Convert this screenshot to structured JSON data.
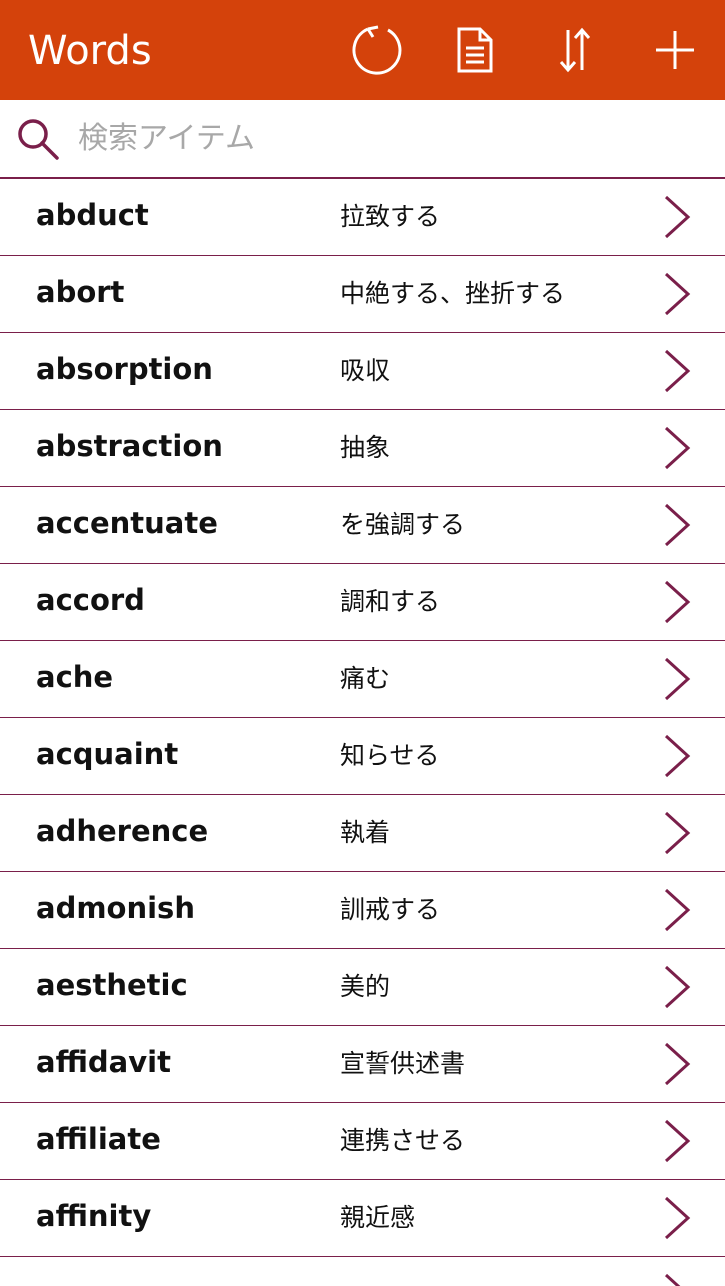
{
  "header": {
    "title": "Words",
    "icons": [
      "refresh-icon",
      "document-icon",
      "sort-icon",
      "add-icon"
    ],
    "background_color": "#d4420b"
  },
  "search": {
    "placeholder": "検索アイテム",
    "value": "",
    "icon": "search-icon"
  },
  "accent_color": "#7a1f4a",
  "words": [
    {
      "word": "abduct",
      "meaning": "拉致する"
    },
    {
      "word": "abort",
      "meaning": "中絶する、挫折する"
    },
    {
      "word": "absorption",
      "meaning": "吸収"
    },
    {
      "word": "abstraction",
      "meaning": "抽象"
    },
    {
      "word": "accentuate",
      "meaning": "を強調する"
    },
    {
      "word": "accord",
      "meaning": "調和する"
    },
    {
      "word": "ache",
      "meaning": "痛む"
    },
    {
      "word": "acquaint",
      "meaning": "知らせる"
    },
    {
      "word": "adherence",
      "meaning": "執着"
    },
    {
      "word": "admonish",
      "meaning": "訓戒する"
    },
    {
      "word": "aesthetic",
      "meaning": "美的"
    },
    {
      "word": "affidavit",
      "meaning": "宣誓供述書"
    },
    {
      "word": "affiliate",
      "meaning": "連携させる"
    },
    {
      "word": "affinity",
      "meaning": "親近感"
    }
  ]
}
